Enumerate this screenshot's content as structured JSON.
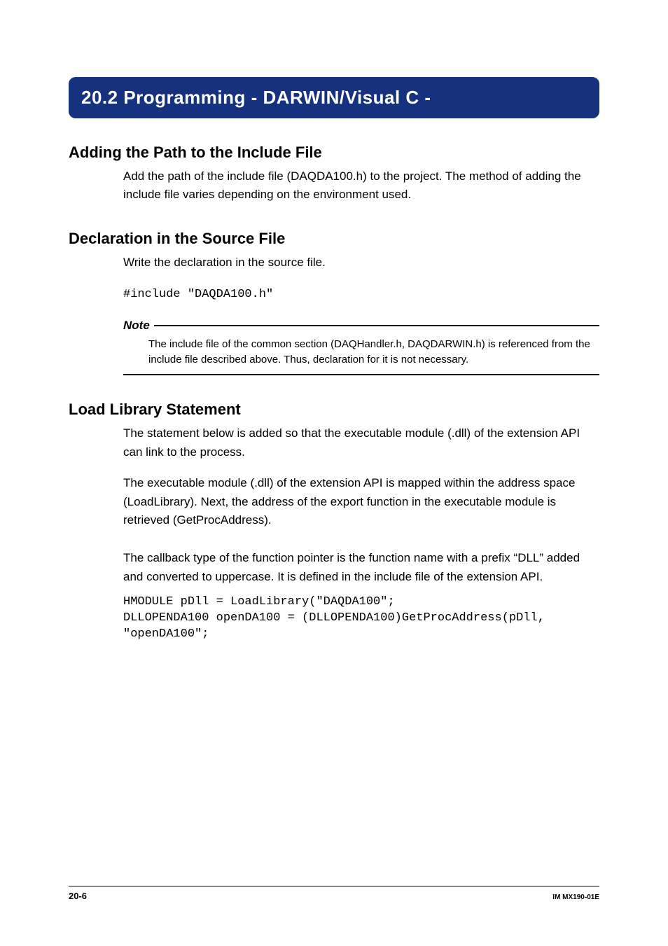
{
  "banner": {
    "title": "20.2  Programming - DARWIN/Visual C -"
  },
  "section_include": {
    "heading": "Adding the Path to the Include File",
    "body": "Add the path of the include file (DAQDA100.h) to the project. The method of adding the include file varies depending on the environment used."
  },
  "section_declare": {
    "heading": "Declaration in the Source File",
    "body": "Write the declaration in the source file.",
    "code": "#include \"DAQDA100.h\""
  },
  "note": {
    "label": "Note",
    "body": "The include file of the common section (DAQHandler.h, DAQDARWIN.h) is referenced from the include file described above. Thus, declaration for it is not necessary."
  },
  "section_load": {
    "heading": "Load Library Statement",
    "body1": "The statement below is added so that the executable module (.dll) of the extension API can link to the process.",
    "body2": "The executable module (.dll) of the extension API is mapped within the address space (LoadLibrary). Next, the address of the export function in the executable module is retrieved (GetProcAddress).",
    "body3": "The callback type of the function pointer is the function name with a prefix “DLL” added and converted to uppercase. It is defined in the include file of the extension API.",
    "code": "HMODULE pDll = LoadLibrary(\"DAQDA100\";\nDLLOPENDA100 openDA100 = (DLLOPENDA100)GetProcAddress(pDll,\n\"openDA100\";"
  },
  "footer": {
    "page": "20-6",
    "docid": "IM MX190-01E"
  }
}
